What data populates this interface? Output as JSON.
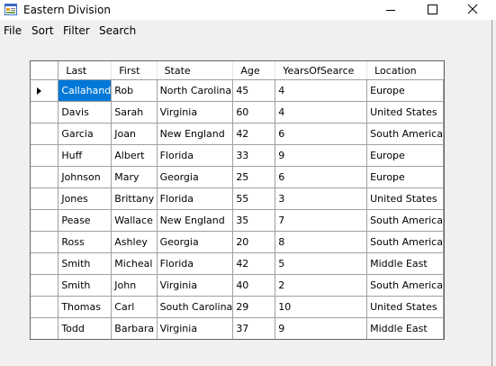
{
  "window": {
    "title": "Eastern Division",
    "icon": "windows-form-icon",
    "controls": [
      "minimize-icon",
      "maximize-icon",
      "close-icon"
    ]
  },
  "menu": {
    "file": "File",
    "sort": "Sort",
    "filter": "Filter",
    "search": "Search"
  },
  "grid": {
    "columns": [
      "Last",
      "First",
      "State",
      "Age",
      "YearsOfSearce",
      "Location"
    ],
    "current_row_marker": "row-pointer-icon",
    "selection_color": "#0078d7",
    "rows": [
      [
        "Callahand",
        "Rob",
        "North Carolina",
        "45",
        "4",
        "Europe"
      ],
      [
        "Davis",
        "Sarah",
        "Virginia",
        "60",
        "4",
        "United States"
      ],
      [
        "Garcia",
        "Joan",
        "New England",
        "42",
        "6",
        "South America"
      ],
      [
        "Huff",
        "Albert",
        "Florida",
        "33",
        "9",
        "Europe"
      ],
      [
        "Johnson",
        "Mary",
        "Georgia",
        "25",
        "6",
        "Europe"
      ],
      [
        "Jones",
        "Brittany",
        "Florida",
        "55",
        "3",
        "United States"
      ],
      [
        "Pease",
        "Wallace",
        "New England",
        "35",
        "7",
        "South America"
      ],
      [
        "Ross",
        "Ashley",
        "Georgia",
        "20",
        "8",
        "South America"
      ],
      [
        "Smith",
        "Micheal",
        "Florida",
        "42",
        "5",
        "Middle East"
      ],
      [
        "Smith",
        "John",
        "Virginia",
        "40",
        "2",
        "South America"
      ],
      [
        "Thomas",
        "Carl",
        "South Carolina",
        "29",
        "10",
        "United States"
      ],
      [
        "Todd",
        "Barbara",
        "Virginia",
        "37",
        "9",
        "Middle East"
      ]
    ]
  }
}
